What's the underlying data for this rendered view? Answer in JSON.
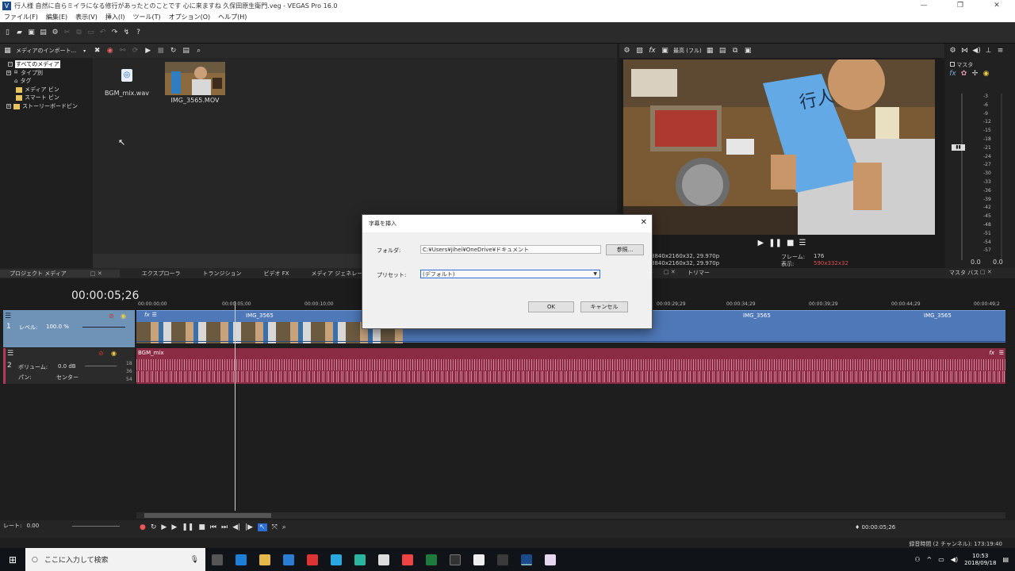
{
  "window": {
    "title": "行人様 自然に自らミイラになる修行があったとのことです 心に来ますね 久保田原生衛門.veg - VEGAS Pro 16.0",
    "controls": [
      "—",
      "❐",
      "✕"
    ]
  },
  "menu": [
    "ファイル(F)",
    "編集(E)",
    "表示(V)",
    "挿入(I)",
    "ツール(T)",
    "オプション(O)",
    "ヘルプ(H)"
  ],
  "media_toolbar": {
    "import_label": "メディアのインポート..."
  },
  "tree": {
    "items": [
      {
        "label": "すべてのメディア",
        "selected": true
      },
      {
        "label": "タイプ別"
      },
      {
        "label": "タグ"
      },
      {
        "label": "メディア ビン"
      },
      {
        "label": "スマート ビン"
      },
      {
        "label": "ストーリーボードビン"
      }
    ]
  },
  "media": {
    "items": [
      {
        "name": "BGM_mix.wav",
        "kind": "audio"
      },
      {
        "name": "IMG_3565.MOV",
        "kind": "video"
      }
    ]
  },
  "bottom_tabs": [
    "プロジェクト メディア",
    "エクスプローラ",
    "トランジション",
    "ビデオ FX",
    "メディア ジェネレータ"
  ],
  "preview": {
    "quality": "最高 (フル)",
    "project_info": "3840x2160x32, 29.970p",
    "preview_info": "3840x2160x32, 29.970p",
    "frame_label": "フレーム:",
    "frame_value": "176",
    "display_label": "表示:",
    "display_value": "590x332x32",
    "video_label": "ー"
  },
  "master": {
    "title": "マスタ",
    "scale": [
      "3",
      "6",
      "9",
      "12",
      "15",
      "18",
      "21",
      "24",
      "27",
      "30",
      "33",
      "36",
      "39",
      "42",
      "45",
      "48",
      "51",
      "54",
      "57"
    ],
    "readout_left": "0.0",
    "readout_right": "0.0"
  },
  "right_tabs": {
    "trimmer": "トリマー",
    "master_bus": "マスタ バス"
  },
  "timeline": {
    "timecode": "00:00:05;26",
    "ruler": [
      "00:00:00;00",
      "00:00:05;00",
      "00:00:10;00",
      "00:00:29;29",
      "00:00:34;29",
      "00:00:39;29",
      "00:00:44;29",
      "00:00:49;2"
    ],
    "video_track": {
      "number": "1",
      "level_label": "レベル:",
      "level_value": "100.0 %",
      "clip_name": "IMG_3565"
    },
    "audio_track": {
      "number": "2",
      "volume_label": "ボリューム:",
      "volume_value": "0.0 dB",
      "pan_label": "パン:",
      "pan_value": "センター",
      "clip_name": "BGM_mix",
      "db_marks": [
        "18",
        "36",
        "54"
      ]
    }
  },
  "transport": {
    "rate_label": "レート:",
    "rate_value": "0.00",
    "cursor_time": "00:00:05;26"
  },
  "status": {
    "text": "録音時間 (2 チャンネル): 173:19:40"
  },
  "taskbar": {
    "search_placeholder": "ここに入力して検索",
    "time": "10:53",
    "date": "2018/09/18"
  },
  "dialog": {
    "title": "字幕を挿入",
    "folder_label": "フォルダ:",
    "folder_value": "C:¥Users¥jihei¥OneDrive¥ドキュメント",
    "browse_label": "参照...",
    "preset_label": "プリセット:",
    "preset_value": "(デフォルト)",
    "ok_label": "OK",
    "cancel_label": "キャンセル"
  }
}
